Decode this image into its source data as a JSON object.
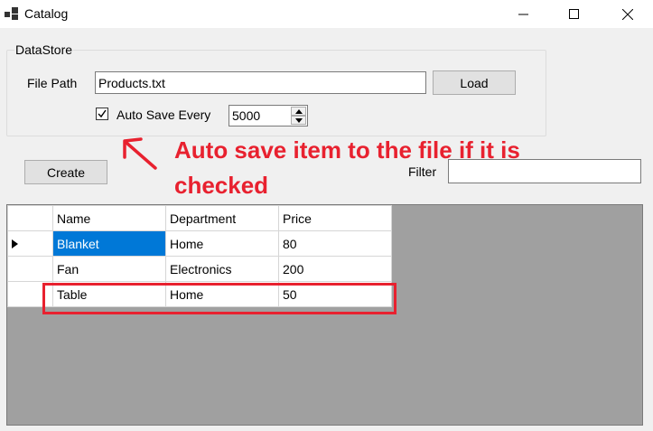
{
  "window": {
    "title": "Catalog"
  },
  "datastore": {
    "group_title": "DataStore",
    "file_path_label": "File Path",
    "file_path_value": "Products.txt",
    "load_label": "Load",
    "auto_save_label": "Auto Save Every",
    "auto_save_checked": true,
    "interval_value": "5000"
  },
  "toolbar": {
    "create_label": "Create",
    "filter_label": "Filter",
    "filter_value": ""
  },
  "annotation": {
    "line1": "Auto save item to the file if it is",
    "line2": "checked",
    "color": "#e8212f"
  },
  "grid": {
    "columns": [
      "Name",
      "Department",
      "Price"
    ],
    "rows": [
      {
        "name": "Blanket",
        "department": "Home",
        "price": "80"
      },
      {
        "name": "Fan",
        "department": "Electronics",
        "price": "200"
      },
      {
        "name": "Table",
        "department": "Home",
        "price": "50"
      }
    ]
  },
  "icons": [
    "app-icon",
    "minimize-icon",
    "maximize-icon",
    "close-icon",
    "checkmark-icon",
    "row-pointer-icon",
    "arrow-up-icon",
    "arrow-down-icon",
    "hand-drawn-arrow-icon"
  ],
  "colors": {
    "selection": "#0078d7",
    "annotation_red": "#e8212f",
    "grid_background": "#a0a0a0"
  }
}
